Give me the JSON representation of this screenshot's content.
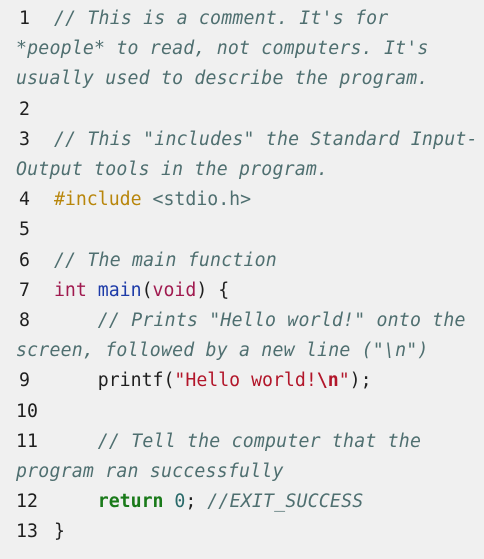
{
  "lines": {
    "l1": {
      "num": "1",
      "comment": "// This is a comment. It's for *people* to read, not computers. It's usually used to describe the program."
    },
    "l2": {
      "num": "2"
    },
    "l3": {
      "num": "3",
      "comment": "// This \"includes\" the Standard Input-Output tools in the program."
    },
    "l4": {
      "num": "4",
      "directive": "#include",
      "header": "<stdio.h>"
    },
    "l5": {
      "num": "5"
    },
    "l6": {
      "num": "6",
      "comment": "// The main function"
    },
    "l7": {
      "num": "7",
      "type": "int",
      "func": "main",
      "open_paren": "(",
      "param": "void",
      "close": ") {"
    },
    "l8": {
      "num": "8",
      "indent": "    ",
      "comment": "// Prints \"Hello world!\" onto the screen, followed by a new line (\"\\n\")"
    },
    "l9": {
      "num": "9",
      "indent": "    ",
      "call": "printf(",
      "str_open": "\"Hello world!",
      "escape": "\\n",
      "str_close": "\"",
      "end": ");"
    },
    "l10": {
      "num": "10"
    },
    "l11": {
      "num": "11",
      "indent": "    ",
      "comment": "// Tell the computer that the program ran successfully"
    },
    "l12": {
      "num": "12",
      "indent": "    ",
      "keyword": "return",
      "value": "0",
      "semicolon": ";",
      "comment": "//EXIT_SUCCESS"
    },
    "l13": {
      "num": "13",
      "close": "}"
    }
  }
}
